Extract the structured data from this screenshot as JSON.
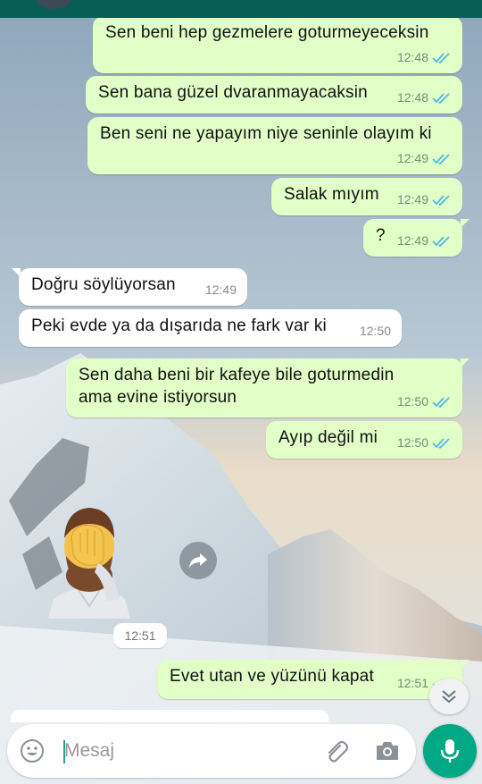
{
  "messages": [
    {
      "text": "Sen beni hep gezmelere goturmeyeceksin",
      "time": "12:48",
      "direction": "outgoing",
      "status": "read"
    },
    {
      "text": "Sen bana güzel dvaranmayacaksin",
      "time": "12:48",
      "direction": "outgoing",
      "status": "read"
    },
    {
      "text": "Ben seni ne yapayım niye seninle olayım ki",
      "time": "12:49",
      "direction": "outgoing",
      "status": "read"
    },
    {
      "text": "Salak mıyım",
      "time": "12:49",
      "direction": "outgoing",
      "status": "read"
    },
    {
      "text": "?",
      "time": "12:49",
      "direction": "outgoing",
      "status": "read"
    },
    {
      "text": "Doğru söylüyorsan",
      "time": "12:49",
      "direction": "incoming"
    },
    {
      "text": "Peki evde ya da dışarıda ne fark var ki",
      "time": "12:50",
      "direction": "incoming"
    },
    {
      "text": "Sen daha beni bir kafeye bile goturmedin ama evine istiyorsun",
      "line1": "Sen daha beni bir kafeye bile goturmedin",
      "line2": "ama evine istiyorsun",
      "time": "12:50",
      "direction": "outgoing",
      "status": "read"
    },
    {
      "text": "Ayıp değil mi",
      "time": "12:50",
      "direction": "outgoing",
      "status": "read"
    },
    {
      "sticker": "facepalm-sticker",
      "time": "12:51",
      "direction": "incoming"
    },
    {
      "text": "Evet utan ve yüzünü kapat",
      "time": "12:51",
      "direction": "outgoing",
      "status": "read"
    }
  ],
  "composer": {
    "placeholder": "Mesaj"
  },
  "icons": {
    "emoji": "emoji-icon",
    "attach": "paperclip-icon",
    "camera": "camera-icon",
    "mic": "microphone-icon",
    "forward": "forward-icon",
    "scroll": "chevron-double-down-icon",
    "read_ticks": "double-check-icon"
  },
  "colors": {
    "header": "#075e54",
    "outgoing_bubble": "#e1ffc7",
    "incoming_bubble": "#ffffff",
    "read_ticks": "#4fb6ec",
    "mic_button": "#00a884"
  }
}
